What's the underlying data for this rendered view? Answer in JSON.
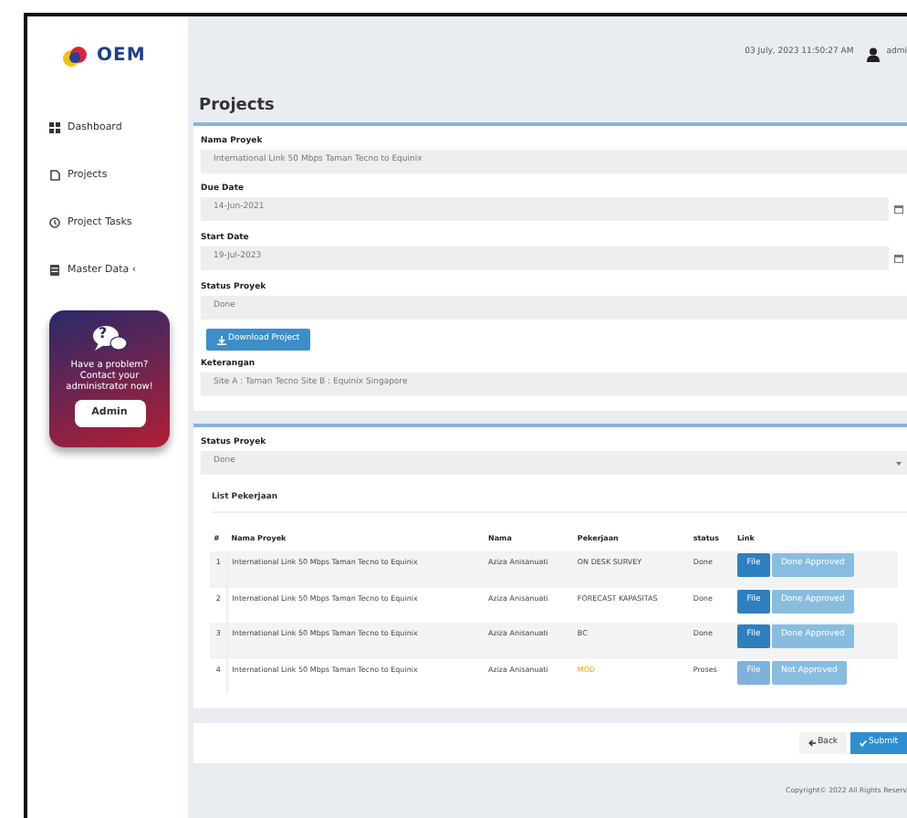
{
  "brand": {
    "name": "OEM"
  },
  "sidebar": {
    "items": [
      {
        "label": "Dashboard",
        "selected": false
      },
      {
        "label": "Projects",
        "selected": false
      },
      {
        "label": "Project Tasks",
        "selected": false
      },
      {
        "label": "Master Data",
        "selected": false,
        "caret": "‹"
      }
    ]
  },
  "help_card": {
    "mark": "?",
    "text": "Have a problem? Contact your administrator now!",
    "button": "Admin"
  },
  "header": {
    "datetime": "03 July, 2023 11:50:27 AM",
    "user": "admi"
  },
  "page_title": "Projects",
  "form": {
    "fields": [
      {
        "label": "Nama Proyek",
        "value": "International Link 50 Mbps Taman Tecno to Equinix",
        "kind": "text"
      },
      {
        "label": "Due Date",
        "value": "14-Jun-2021",
        "kind": "date"
      },
      {
        "label": "Start Date",
        "value": "19-Jul-2023",
        "kind": "date"
      },
      {
        "label": "Status Proyek",
        "value": "Done",
        "kind": "text"
      }
    ],
    "download_button": "Download Project",
    "note": {
      "label": "Keterangan",
      "value": "Site A : Taman Tecno Site B : Equinix Singapore"
    }
  },
  "status_select": {
    "label": "Status Proyek",
    "value": "Done"
  },
  "list_title": "List Pekerjaan",
  "table": {
    "columns": [
      "#",
      "Nama Proyek",
      "Nama",
      "Pekerjaan",
      "status",
      "Link"
    ],
    "rows": [
      {
        "no": "1",
        "project": "International Link 50 Mbps Taman Tecno to Equinix",
        "name": "Aziza Anisanuati",
        "job": "ON DESK SURVEY",
        "highlight": false,
        "status": "Done",
        "file": "File",
        "file_disabled": false,
        "approval": "Done Approved"
      },
      {
        "no": "2",
        "project": "International Link 50 Mbps Taman Tecno to Equinix",
        "name": "Aziza Anisanuati",
        "job": "FORECAST KAPASITAS",
        "highlight": false,
        "status": "Done",
        "file": "File",
        "file_disabled": false,
        "approval": "Done Approved"
      },
      {
        "no": "3",
        "project": "International Link 50 Mbps Taman Tecno to Equinix",
        "name": "Aziza Anisanuati",
        "job": "BC",
        "highlight": false,
        "status": "Done",
        "file": "File",
        "file_disabled": false,
        "approval": "Done Approved"
      },
      {
        "no": "4",
        "project": "International Link 50 Mbps Taman Tecno to Equinix",
        "name": "Aziza Anisanuati",
        "job": "MOD",
        "highlight": true,
        "status": "Proses",
        "file": "File",
        "file_disabled": true,
        "approval": "Not Approved"
      }
    ]
  },
  "actions": {
    "back": "Back",
    "submit": "Submit"
  },
  "footer": "Copyright© 2022 All Rights Reserv"
}
